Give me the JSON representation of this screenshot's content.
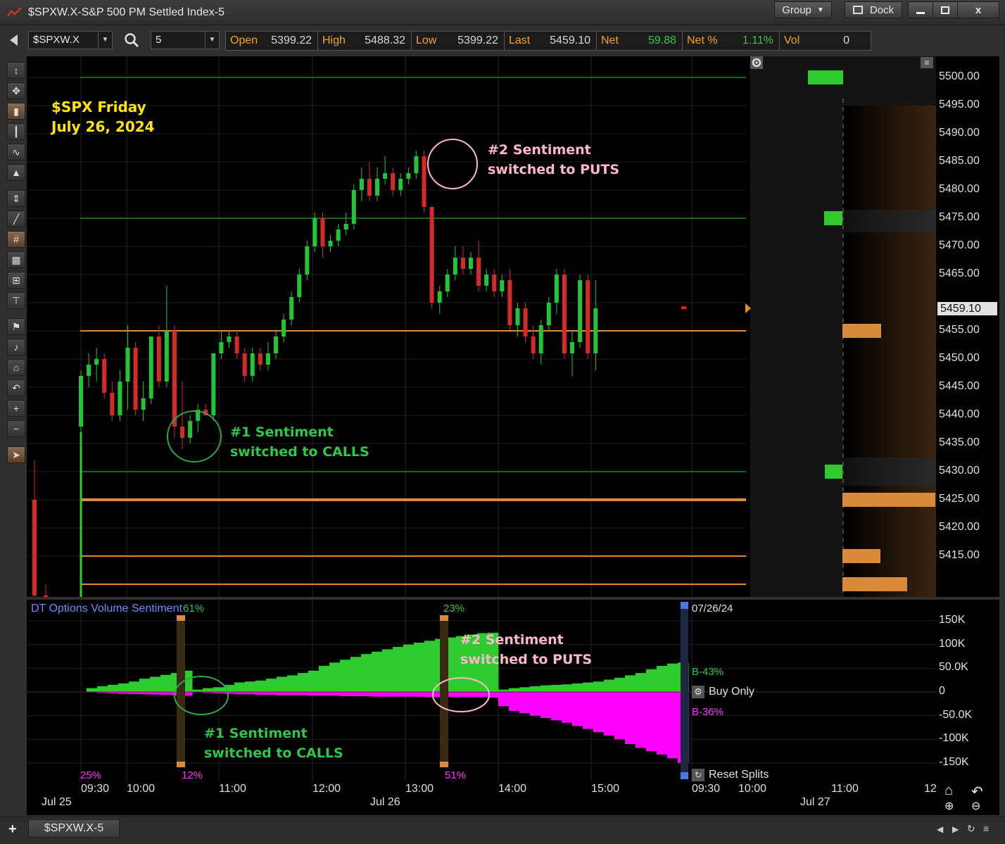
{
  "window": {
    "title": "$SPXW.X-S&P 500 PM Settled Index-5",
    "group_label": "Group",
    "dock_label": "Dock",
    "minimize_icon": "minimize-icon",
    "maximize_icon": "maximize-icon",
    "close_label": "x"
  },
  "toolbar": {
    "symbol": "$SPXW.X",
    "interval": "5",
    "quote": {
      "open_label": "Open",
      "open": "5399.22",
      "high_label": "High",
      "high": "5488.32",
      "low_label": "Low",
      "low": "5399.22",
      "last_label": "Last",
      "last": "5459.10",
      "net_label": "Net",
      "net": "59.88",
      "netpct_label": "Net %",
      "netpct": "1.11%",
      "vol_label": "Vol",
      "vol": "0"
    }
  },
  "annotations": {
    "title_line1": "$SPX Friday",
    "title_line2": "July 26, 2024",
    "s1_line1": "#1 Sentiment",
    "s1_line2": "switched to CALLS",
    "s2_line1": "#2 Sentiment",
    "s2_line2": "switched to PUTS"
  },
  "price_axis": {
    "ticks": [
      "5500.00",
      "5495.00",
      "5490.00",
      "5485.00",
      "5480.00",
      "5475.00",
      "5470.00",
      "5465.00",
      "5455.00",
      "5450.00",
      "5445.00",
      "5440.00",
      "5435.00",
      "5430.00",
      "5425.00",
      "5420.00",
      "5415.00"
    ],
    "last_tag": "5459.10"
  },
  "sentiment": {
    "title": "DT Options Volume Sentiment",
    "pct_top_left": "61%",
    "pct_top_mid": "23%",
    "pct_bot_1": "25%",
    "pct_bot_2": "12%",
    "pct_bot_3": "51%",
    "date_label": "07/26/24",
    "b_calls": "B-43%",
    "b_puts": "B-36%",
    "buy_only": "Buy Only",
    "reset_splits": "Reset Splits",
    "axis_ticks": [
      "150K",
      "100K",
      "50.0K",
      "0",
      "-50.0K",
      "-100K",
      "-150K"
    ]
  },
  "time_axis": {
    "times": [
      "09:30",
      "10:00",
      "11:00",
      "12:00",
      "13:00",
      "14:00",
      "15:00",
      "09:30",
      "10:00",
      "11:00",
      "12"
    ],
    "dates": [
      "Jul 25",
      "Jul 26",
      "Jul 27"
    ]
  },
  "bottom": {
    "sheet_tab": "$SPXW.X-5",
    "add_label": "+"
  },
  "colors": {
    "up_candle": "#22c43a",
    "down_candle": "#d42a2a",
    "call_volume": "#2ecc30",
    "put_volume": "#ff00ff",
    "level_green": "#2ecc30",
    "level_orange": "#d98a3a",
    "quote_label": "#f0a520"
  },
  "chart_data": {
    "type": "candlestick",
    "price_ylim": [
      5410,
      5500
    ],
    "candles": [
      [
        5425,
        5432,
        5395,
        5408
      ],
      [
        5408,
        5410,
        5390,
        5395
      ],
      [
        5395,
        5398,
        5370,
        5380
      ],
      [
        5438,
        5448,
        5435,
        5447
      ],
      [
        5447,
        5451,
        5445,
        5449
      ],
      [
        5449,
        5452,
        5446,
        5450
      ],
      [
        5450,
        5451,
        5443,
        5444
      ],
      [
        5444,
        5446,
        5439,
        5440
      ],
      [
        5440,
        5448,
        5439,
        5446
      ],
      [
        5446,
        5456,
        5441,
        5452
      ],
      [
        5452,
        5453,
        5440,
        5441
      ],
      [
        5441,
        5446,
        5439,
        5443
      ],
      [
        5443,
        5452,
        5442,
        5454
      ],
      [
        5454,
        5456,
        5445,
        5446
      ],
      [
        5446,
        5463,
        5445,
        5455
      ],
      [
        5455,
        5456,
        5436,
        5438
      ],
      [
        5438,
        5446,
        5434,
        5436
      ],
      [
        5436,
        5440,
        5435,
        5439
      ],
      [
        5439,
        5442,
        5437,
        5441
      ],
      [
        5441,
        5442,
        5440,
        5440
      ],
      [
        5440,
        5451,
        5439,
        5451
      ],
      [
        5451,
        5455,
        5450,
        5453
      ],
      [
        5453,
        5455,
        5452,
        5454
      ],
      [
        5454,
        5455,
        5450,
        5451
      ],
      [
        5451,
        5452,
        5446,
        5447
      ],
      [
        5447,
        5452,
        5446,
        5451
      ],
      [
        5451,
        5452,
        5448,
        5449
      ],
      [
        5449,
        5453,
        5448,
        5451
      ],
      [
        5451,
        5455,
        5450,
        5454
      ],
      [
        5454,
        5458,
        5453,
        5457
      ],
      [
        5457,
        5462,
        5456,
        5461
      ],
      [
        5461,
        5466,
        5460,
        5465
      ],
      [
        5465,
        5471,
        5464,
        5470
      ],
      [
        5470,
        5476,
        5469,
        5475
      ],
      [
        5475,
        5476,
        5468,
        5470
      ],
      [
        5470,
        5472,
        5469,
        5471
      ],
      [
        5471,
        5474,
        5470,
        5473
      ],
      [
        5473,
        5476,
        5472,
        5474
      ],
      [
        5474,
        5481,
        5473,
        5480
      ],
      [
        5480,
        5484,
        5478,
        5482
      ],
      [
        5482,
        5485,
        5478,
        5479
      ],
      [
        5479,
        5484,
        5478,
        5482
      ],
      [
        5482,
        5486,
        5481,
        5483
      ],
      [
        5483,
        5484,
        5479,
        5480
      ],
      [
        5480,
        5483,
        5479,
        5482
      ],
      [
        5482,
        5484,
        5481,
        5483
      ],
      [
        5483,
        5487,
        5482,
        5486
      ],
      [
        5486,
        5487,
        5476,
        5477
      ],
      [
        5477,
        5477,
        5459,
        5460
      ],
      [
        5460,
        5463,
        5458,
        5462
      ],
      [
        5462,
        5466,
        5461,
        5465
      ],
      [
        5465,
        5470,
        5464,
        5468
      ],
      [
        5468,
        5470,
        5465,
        5466
      ],
      [
        5466,
        5469,
        5465,
        5468
      ],
      [
        5468,
        5471,
        5462,
        5463
      ],
      [
        5463,
        5466,
        5462,
        5465
      ],
      [
        5465,
        5466,
        5461,
        5462
      ],
      [
        5462,
        5465,
        5461,
        5464
      ],
      [
        5464,
        5466,
        5455,
        5456
      ],
      [
        5456,
        5460,
        5454,
        5459
      ],
      [
        5459,
        5460,
        5453,
        5454
      ],
      [
        5454,
        5456,
        5450,
        5451
      ],
      [
        5451,
        5457,
        5449,
        5456
      ],
      [
        5456,
        5461,
        5455,
        5460
      ],
      [
        5460,
        5466,
        5458,
        5465
      ],
      [
        5465,
        5466,
        5450,
        5451
      ],
      [
        5451,
        5455,
        5447,
        5453
      ],
      [
        5453,
        5465,
        5452,
        5464
      ],
      [
        5464,
        5465,
        5450,
        5451
      ],
      [
        5451,
        5464,
        5448,
        5459
      ]
    ],
    "levels": [
      {
        "price": 5500,
        "color": "green",
        "volume_bar": "call"
      },
      {
        "price": 5475,
        "color": "green",
        "volume_bar": "call"
      },
      {
        "price": 5455,
        "color": "orange",
        "volume_bar": "put"
      },
      {
        "price": 5430,
        "color": "green",
        "volume_bar": "call"
      },
      {
        "price": 5425,
        "color": "orange",
        "volume_bar": "put"
      },
      {
        "price": 5415,
        "color": "orange",
        "volume_bar": "put"
      },
      {
        "price": 5410,
        "color": "orange",
        "volume_bar": "put"
      }
    ],
    "volume_ylim": [
      -165000,
      165000
    ],
    "calls_cumulative": [
      0,
      5000,
      12000,
      15000,
      18000,
      22000,
      28000,
      35000,
      40000,
      45000,
      55000,
      5000,
      8000,
      10000,
      15000,
      20000,
      22000,
      24000,
      28000,
      32000,
      35000,
      40000,
      45000,
      55000,
      62000,
      68000,
      74000,
      80000,
      85000,
      90000,
      95000,
      100000,
      104000,
      108000,
      112000,
      115000,
      118000,
      121000,
      124000,
      125000,
      5000,
      8000,
      10000,
      12000,
      14000,
      15000,
      16000,
      18000,
      20000,
      22000,
      26000,
      30000,
      35000,
      40000,
      48000,
      55000,
      60000,
      62000
    ],
    "puts_cumulative": [
      0,
      -1000,
      -2000,
      -3000,
      -4000,
      -4500,
      -5000,
      -5500,
      -6000,
      -7000,
      -8000,
      -1000,
      -2000,
      -3000,
      -4000,
      -5000,
      -5000,
      -6000,
      -6000,
      -7000,
      -7000,
      -7000,
      -8000,
      -8000,
      -8000,
      -9000,
      -9000,
      -9000,
      -10000,
      -10000,
      -10000,
      -10000,
      -10000,
      -11000,
      -11000,
      -11000,
      -11000,
      -11000,
      -11000,
      -12000,
      -30000,
      -40000,
      -45000,
      -50000,
      -55000,
      -60000,
      -65000,
      -72000,
      -78000,
      -85000,
      -92000,
      -100000,
      -110000,
      -118000,
      -125000,
      -132000,
      -140000,
      -150000
    ]
  }
}
